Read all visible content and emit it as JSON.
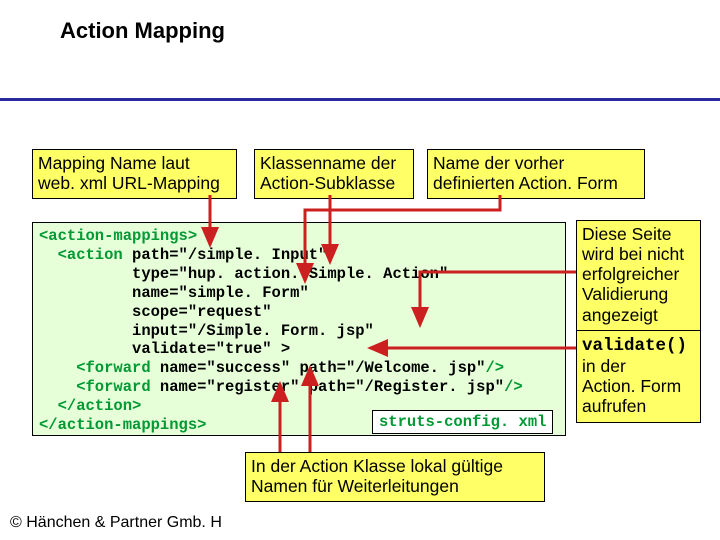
{
  "title": "Action Mapping",
  "boxes": {
    "top1": "Mapping Name laut\nweb. xml URL-Mapping",
    "top2": "Klassenname der\nAction-Subklasse",
    "top3": "Name der vorher\ndefinierten Action. Form",
    "sidebox": "Diese Seite\nwird bei nicht\nerfolgreicher\nValidierung\nangezeigt",
    "notebox": "validate()\nin der\nAction. Form\naufrufen",
    "bottombox": "In der Action Klasse lokal gültige\nNamen für Weiterleitungen"
  },
  "code": {
    "l1a": "<action-mappings>",
    "l2a": "  <action ",
    "l2b": "path=\"/simple. Input\"",
    "l3a": "          ",
    "l3b": "type=\"hup. action. Simple. Action\"",
    "l4a": "          ",
    "l4b": "name=\"simple. Form\"",
    "l5a": "          ",
    "l5b": "scope=\"request\"",
    "l6a": "          ",
    "l6b": "input=\"/Simple. Form. jsp\"",
    "l7a": "          ",
    "l7b": "validate=\"true\" >",
    "l8a": "    <forward ",
    "l8b": "name=\"success\" path=\"/Welcome. jsp\"",
    "l8c": "/>",
    "l9a": "    <forward ",
    "l9b": "name=\"register\" path=\"/Register. jsp\"",
    "l9c": "/>",
    "l10a": "  </action>",
    "l11a": "</action-mappings>"
  },
  "filelabel": "struts-config. xml",
  "footer": "© Hänchen & Partner Gmb. H",
  "colors": {
    "arrow": "#cc1f1f"
  }
}
